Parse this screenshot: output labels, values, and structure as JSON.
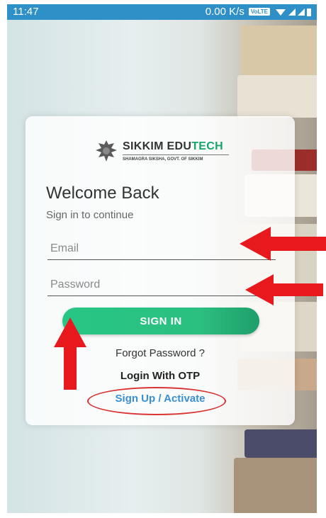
{
  "status_bar": {
    "time": "11:47",
    "network_speed": "0.00 K/s",
    "volte": "VoLTE"
  },
  "logo": {
    "brand_part1": "SIKKIM EDU",
    "brand_part2": "TECH",
    "subtitle": "SHAMAGRA SIKSHA, GOVT. OF SIKKIM"
  },
  "login": {
    "heading": "Welcome Back",
    "subheading": "Sign in to continue",
    "email_placeholder": "Email",
    "password_placeholder": "Password",
    "sign_in_label": "SIGN IN",
    "forgot_password": "Forgot Password ?",
    "login_otp": "Login With OTP",
    "sign_up": "Sign Up / Activate"
  },
  "colors": {
    "status_bar": "#2f90c8",
    "button_green": "#27c686",
    "link_blue": "#3a8fd1",
    "annotation_red": "#e8191d"
  }
}
